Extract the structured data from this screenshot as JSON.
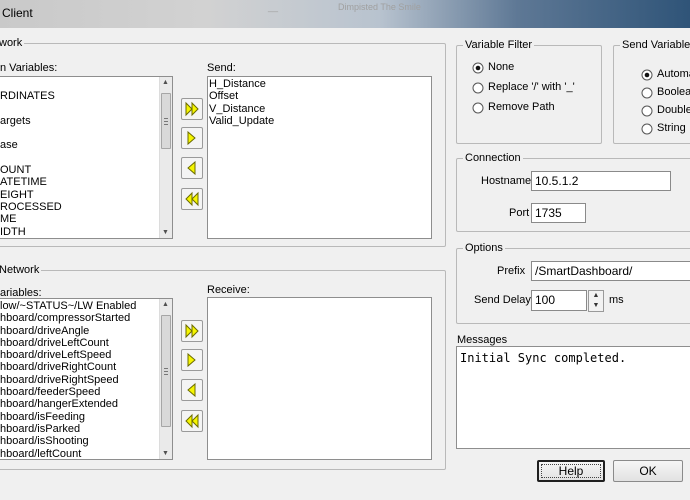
{
  "window": {
    "title": "Client",
    "faint_text_1": "__",
    "faint_text_2": "Dimpisted The Smile"
  },
  "send_network": {
    "group_title": "work",
    "available_label": "n Variables:",
    "available_items": [
      "",
      "RDINATES",
      "",
      "argets",
      "",
      "ase",
      "",
      "OUNT",
      "ATETIME",
      "EIGHT",
      "ROCESSED",
      "ME",
      "IDTH"
    ],
    "send_label": "Send:",
    "send_items": [
      "H_Distance",
      "Offset",
      "V_Distance",
      "Valid_Update"
    ]
  },
  "receive_network": {
    "group_title": "Network",
    "available_label": "ariables:",
    "available_items": [
      "low/~STATUS~/LW Enabled",
      "hboard/compressorStarted",
      "hboard/driveAngle",
      "hboard/driveLeftCount",
      "hboard/driveLeftSpeed",
      "hboard/driveRightCount",
      "hboard/driveRightSpeed",
      "hboard/feederSpeed",
      "hboard/hangerExtended",
      "hboard/isFeeding",
      "hboard/isParked",
      "hboard/isShooting",
      "hboard/leftCount"
    ],
    "receive_label": "Receive:",
    "receive_items": []
  },
  "variable_filter": {
    "group_title": "Variable Filter",
    "options": [
      "None",
      "Replace '/' with '_'",
      "Remove Path"
    ],
    "selected": 0
  },
  "send_variable_type": {
    "group_title": "Send Variable T",
    "options": [
      "Automa",
      "Boolea",
      "Double",
      "String"
    ],
    "selected": 0
  },
  "connection": {
    "group_title": "Connection",
    "hostname_label": "Hostname",
    "hostname_value": "10.5.1.2",
    "port_label": "Port",
    "port_value": "1735"
  },
  "options": {
    "group_title": "Options",
    "prefix_label": "Prefix",
    "prefix_value": "/SmartDashboard/",
    "send_delay_label": "Send Delay",
    "send_delay_value": "100",
    "send_delay_unit": "ms"
  },
  "messages": {
    "label": "Messages",
    "text": "Initial Sync completed."
  },
  "buttons": {
    "help": "Help",
    "ok": "OK"
  },
  "colors": {
    "arrow_fill": "#f5f500",
    "arrow_stroke": "#6b6b00"
  }
}
